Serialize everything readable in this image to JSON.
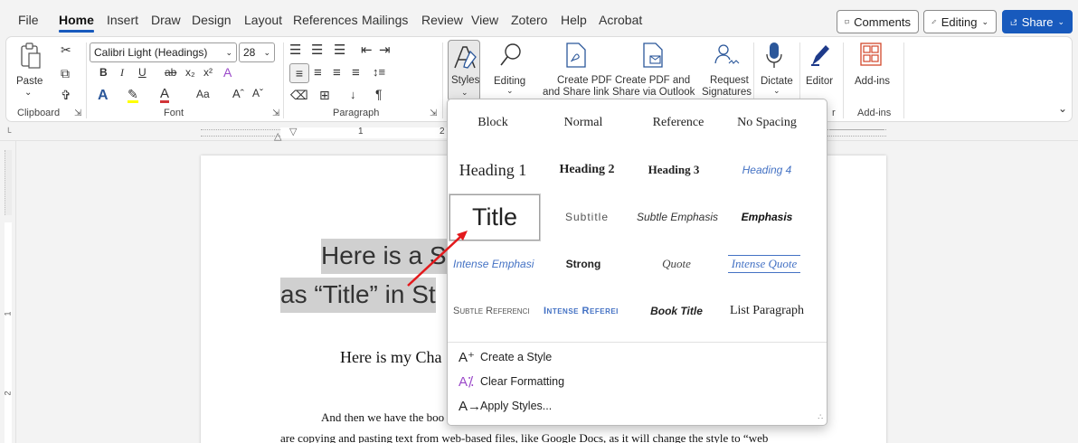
{
  "menu": {
    "tabs": [
      "File",
      "Home",
      "Insert",
      "Draw",
      "Design",
      "Layout",
      "References",
      "Mailings",
      "Review",
      "View",
      "Zotero",
      "Help",
      "Acrobat"
    ],
    "active_tab": "Home",
    "comments_label": "Comments",
    "editing_label": "Editing",
    "share_label": "Share"
  },
  "ribbon": {
    "clipboard": {
      "paste_label": "Paste",
      "group_label": "Clipboard"
    },
    "font": {
      "font_name": "Calibri Light (Headings)",
      "font_size": "28",
      "change_case": "Aa",
      "group_label": "Font"
    },
    "paragraph": {
      "group_label": "Paragraph"
    },
    "styles": {
      "label": "Styles"
    },
    "editing": {
      "label": "Editing"
    },
    "acrobat": {
      "create_pdf_label_1": "Create PDF",
      "create_pdf_label_2": "and Share link",
      "create_pdf_outlook_1": "Create PDF and",
      "create_pdf_outlook_2": "Share via Outlook",
      "request_sig_1": "Request",
      "request_sig_2": "Signatures"
    },
    "dictate": {
      "label": "Dictate"
    },
    "editor": {
      "label": "Editor"
    },
    "addins": {
      "label": "Add-ins",
      "group_label": "Add-ins"
    },
    "voice_group_partial": "r"
  },
  "ruler": {
    "marks": [
      "1",
      "2"
    ]
  },
  "vruler": {
    "marks": [
      "1",
      "2"
    ]
  },
  "document": {
    "title_line1": "Here is a So",
    "title_line2": "as “Title” in St",
    "chapter": "Here is my Cha",
    "body_line1": "And then we have the boo",
    "body_line2": "are copying and pasting text from web-based files, like Google Docs, as it will change the style to “web"
  },
  "styles_gallery": {
    "rows": [
      [
        "Block",
        "Normal",
        "Reference",
        "No Spacing"
      ],
      [
        "Heading 1",
        "Heading 2",
        "Heading 3",
        "Heading 4"
      ],
      [
        "Title",
        "Subtitle",
        "Subtle Emphasis",
        "Emphasis"
      ],
      [
        "Intense Emphasi",
        "Strong",
        "Quote",
        "Intense Quote"
      ],
      [
        "Subtle Referenci",
        "Intense Referei",
        "Book Title",
        "List Paragraph"
      ]
    ],
    "selected": "Title",
    "commands": [
      "Create a Style",
      "Clear Formatting",
      "Apply Styles..."
    ]
  },
  "colors": {
    "accent": "#185abd",
    "heading4": "#4472c4",
    "arrow": "#e3191c",
    "title_highlight": "#d0d0d0"
  }
}
